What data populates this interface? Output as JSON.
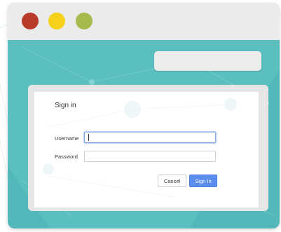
{
  "window": {
    "controls": [
      {
        "name": "close",
        "color": "#b83a29"
      },
      {
        "name": "minimize",
        "color": "#f5d219"
      },
      {
        "name": "maximize",
        "color": "#a7bb4d"
      }
    ],
    "address_bar": {
      "value": ""
    }
  },
  "colors": {
    "background_teal": "#5bbfc0",
    "titlebar": "#ebebeb",
    "accent_button": "#5b8def"
  },
  "dialog": {
    "title": "Sign in",
    "fields": {
      "username": {
        "label": "Username",
        "value": ""
      },
      "password": {
        "label": "Password",
        "value": ""
      }
    },
    "buttons": {
      "cancel": "Cancel",
      "sign_in": "Sign In"
    }
  }
}
